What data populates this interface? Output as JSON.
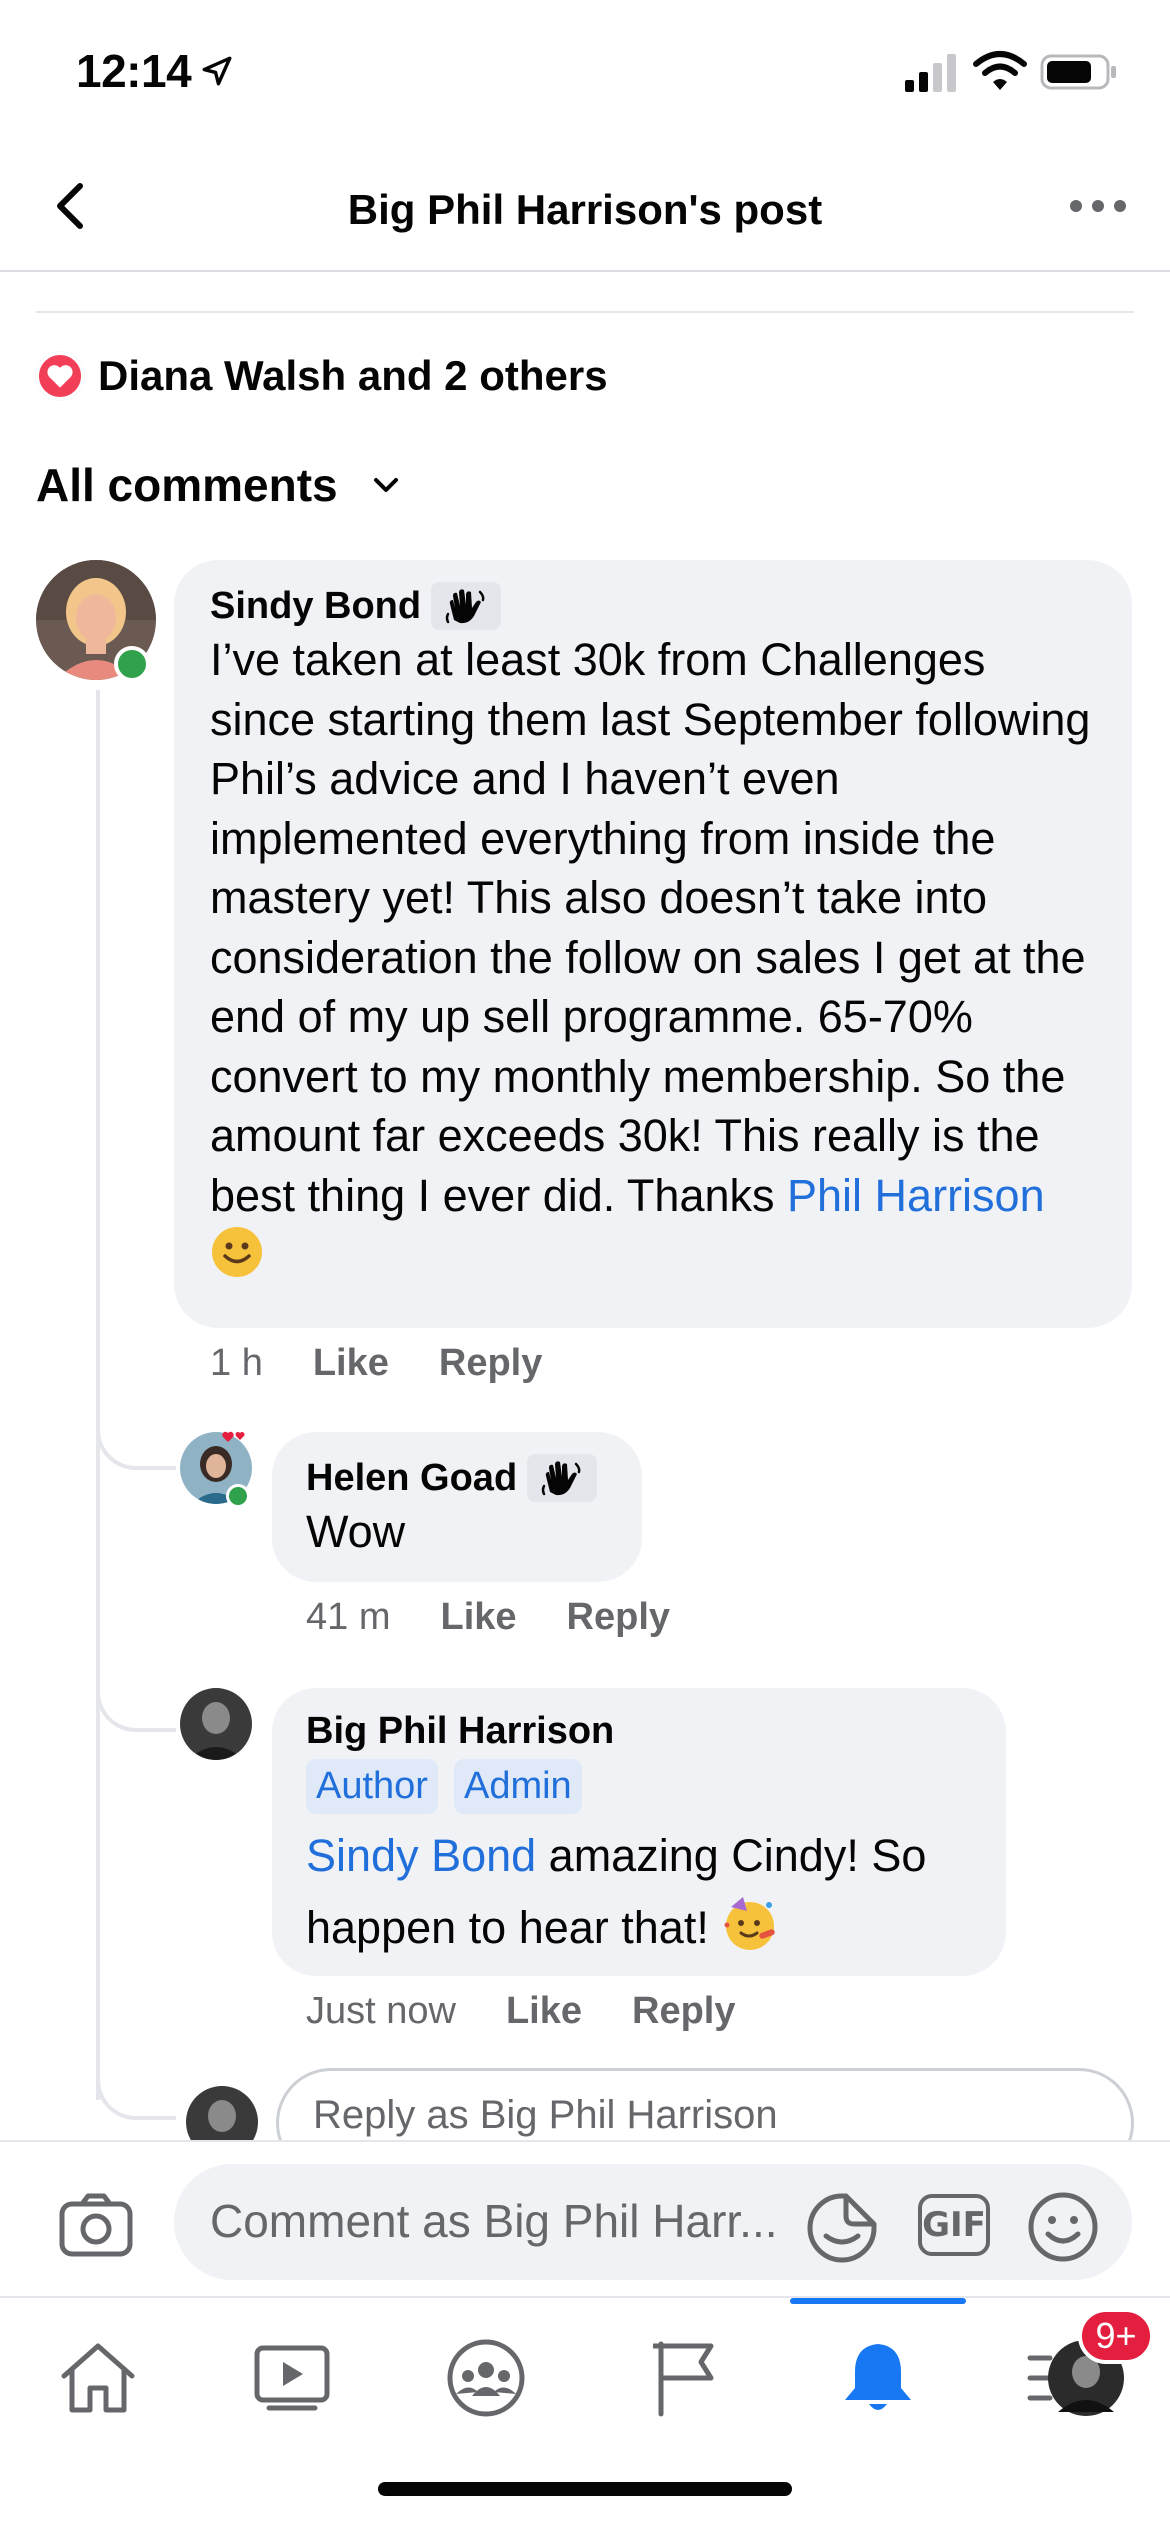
{
  "status_bar": {
    "time": "12:14"
  },
  "header": {
    "title": "Big Phil Harrison's post"
  },
  "reactions": {
    "text": "Diana Walsh and 2 others"
  },
  "sort": {
    "label": "All comments"
  },
  "comments": [
    {
      "author": "Sindy Bond",
      "text": "I’ve taken at least 30k from Challenges since starting them last September following Phil’s advice and I haven’t even implemented everything from inside the mastery yet! This also doesn’t take into consideration the follow on sales I get at the end of my up sell programme. 65-70% convert to my monthly membership. So the amount far exceeds 30k! This really is the best thing I ever did. Thanks ",
      "mention": "Phil Harrison",
      "time": "1 h",
      "like": "Like",
      "reply": "Reply"
    },
    {
      "author": "Helen Goad",
      "text": "Wow",
      "time": "41 m",
      "like": "Like",
      "reply": "Reply"
    },
    {
      "author": "Big Phil Harrison",
      "badges": [
        "Author",
        "Admin"
      ],
      "mention": "Sindy Bond",
      "text": " amazing Cindy! So happen to hear that! ",
      "time": "Just now",
      "like": "Like",
      "reply": "Reply"
    }
  ],
  "reply_input": {
    "placeholder": "Reply as Big Phil Harrison"
  },
  "composer": {
    "placeholder": "Comment as Big Phil Harr...",
    "gif_label": "GIF"
  },
  "tabbar": {
    "notification_count": "9+"
  },
  "colors": {
    "accent": "#1877f2",
    "mention": "#216fdb",
    "online": "#31a24c",
    "badge_red": "#e41e3f",
    "heart": "#f33e58"
  },
  "icons": [
    "location-arrow-icon",
    "signal-icon",
    "wifi-icon",
    "battery-icon",
    "back-chevron-icon",
    "more-dots-icon",
    "heart-icon",
    "chevron-down-icon",
    "wave-icon",
    "camera-icon",
    "sticker-icon",
    "emoji-icon",
    "home-icon",
    "watch-icon",
    "groups-icon",
    "pages-flag-icon",
    "bell-icon",
    "menu-icon"
  ]
}
